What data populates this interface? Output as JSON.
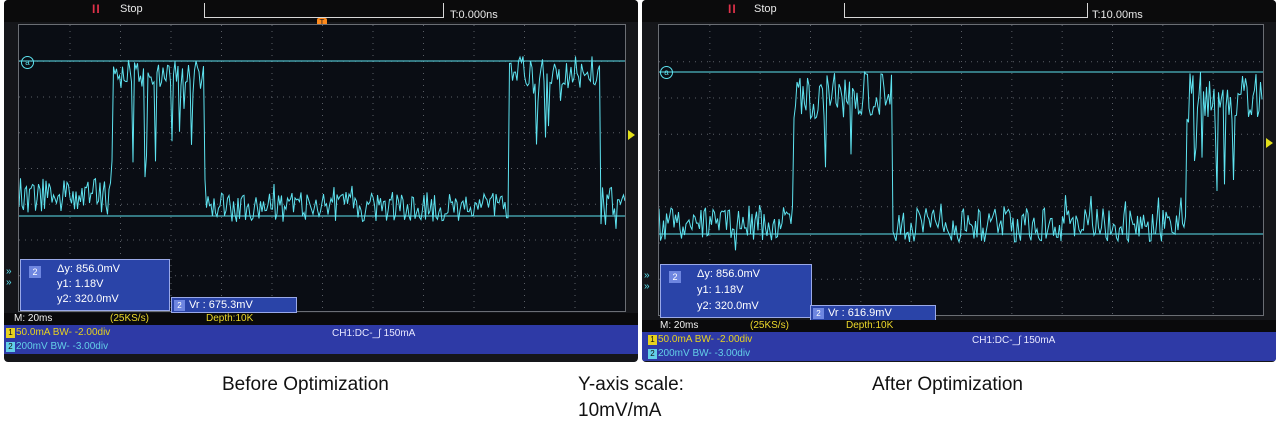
{
  "left_scope": {
    "run_icon": "II",
    "status": "Stop",
    "timebase": "T:0.000ns",
    "marker_a": "a",
    "cursor_label": "2",
    "delta_y": "Δy: 856.0mV",
    "y1": "y1: 1.18V",
    "y2": "y2: 320.0mV",
    "vr_label": "2",
    "vr": "Vr : 675.3mV",
    "m_time": "M: 20ms",
    "sample_rate": "(25KS/s)",
    "depth": "Depth:10K",
    "ch1_num": "1",
    "ch1": "50.0mA BW- -2.00div",
    "ch2_num": "2",
    "ch2": "200mV BW- -3.00div",
    "trigger": "CH1:DC-_∫ 150mA"
  },
  "right_scope": {
    "run_icon": "II",
    "status": "Stop",
    "timebase": "T:10.00ms",
    "marker_a": "a",
    "cursor_label": "2",
    "delta_y": "Δy: 856.0mV",
    "y1": "y1: 1.18V",
    "y2": "y2: 320.0mV",
    "vr_label": "2",
    "vr": "Vr : 616.9mV",
    "m_time": "M: 20ms",
    "sample_rate": "(25KS/s)",
    "depth": "Depth:10K",
    "ch1_num": "1",
    "ch1": "50.0mA BW- -2.00div",
    "ch2_num": "2",
    "ch2": "200mV BW- -3.00div",
    "trigger": "CH1:DC-_∫ 150mA"
  },
  "captions": {
    "before": "Before Optimization",
    "scale_line1": "Y-axis scale:",
    "scale_line2": "10mV/mA",
    "after": "After Optimization"
  },
  "colors": {
    "trace": "#5ee3f0",
    "screen": "#0a0d14",
    "status_bar": "#2e3aa6"
  }
}
